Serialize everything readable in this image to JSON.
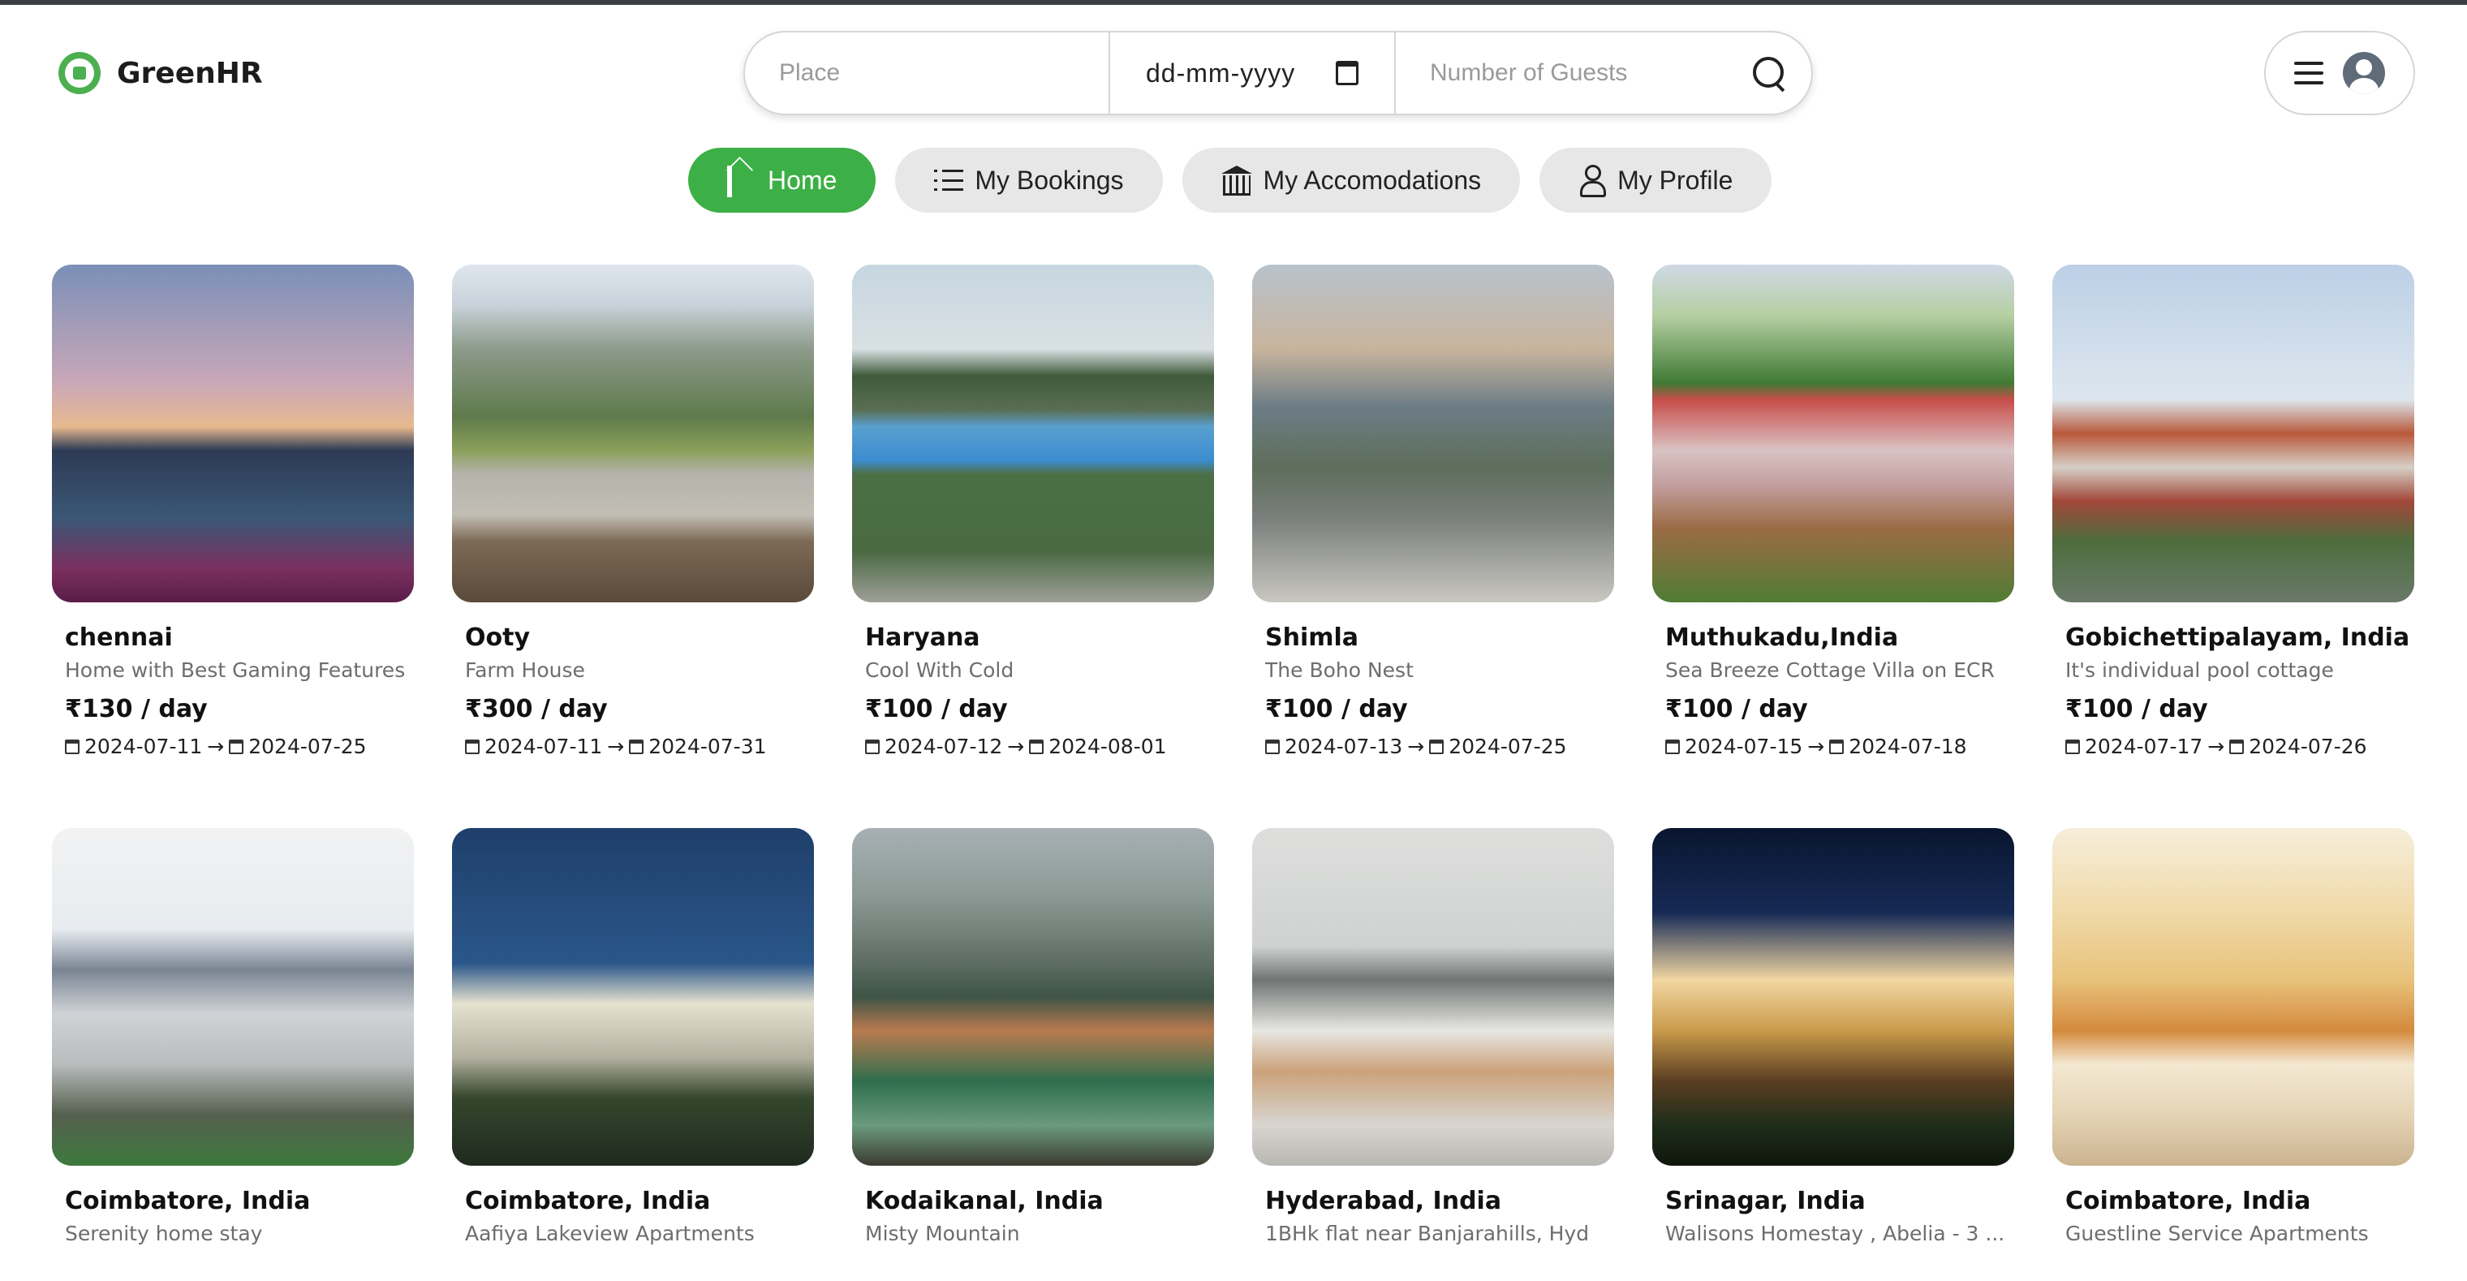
{
  "brand": {
    "name": "GreenHR",
    "logo_icon": "house-leaf-logo",
    "accent": "#3caf46"
  },
  "search": {
    "place_placeholder": "Place",
    "date_value": "dd-mm-yyyy",
    "guests_placeholder": "Number of Guests",
    "search_icon": "search-icon"
  },
  "account": {
    "menu_icon": "hamburger-icon",
    "avatar_icon": "user-avatar-icon"
  },
  "tabs": [
    {
      "label": "Home",
      "icon": "home-icon",
      "active": true
    },
    {
      "label": "My Bookings",
      "icon": "list-icon",
      "active": false
    },
    {
      "label": "My Accomodations",
      "icon": "bank-icon",
      "active": false
    },
    {
      "label": "My Profile",
      "icon": "user-icon",
      "active": false
    }
  ],
  "listings": [
    {
      "title": "chennai",
      "subtitle": "Home with Best Gaming Features",
      "price": "₹130 / day",
      "from": "2024-07-11",
      "to": "2024-07-25"
    },
    {
      "title": "Ooty",
      "subtitle": "Farm House",
      "price": "₹300 / day",
      "from": "2024-07-11",
      "to": "2024-07-31"
    },
    {
      "title": "Haryana",
      "subtitle": "Cool With Cold",
      "price": "₹100 / day",
      "from": "2024-07-12",
      "to": "2024-08-01"
    },
    {
      "title": "Shimla",
      "subtitle": "The Boho Nest",
      "price": "₹100 / day",
      "from": "2024-07-13",
      "to": "2024-07-25"
    },
    {
      "title": "Muthukadu,India",
      "subtitle": "Sea Breeze Cottage Villa on ECR",
      "price": "₹100 / day",
      "from": "2024-07-15",
      "to": "2024-07-18"
    },
    {
      "title": "Gobichettipalayam, India",
      "subtitle": "It's individual pool cottage",
      "price": "₹100 / day",
      "from": "2024-07-17",
      "to": "2024-07-26"
    },
    {
      "title": "Coimbatore, India",
      "subtitle": "Serenity home stay"
    },
    {
      "title": "Coimbatore, India",
      "subtitle": "Aafiya Lakeview Apartments"
    },
    {
      "title": "Kodaikanal, India",
      "subtitle": "Misty Mountain"
    },
    {
      "title": "Hyderabad, India",
      "subtitle": "1BHk flat near Banjarahills, Hyd"
    },
    {
      "title": "Srinagar, India",
      "subtitle": "Walisons Homestay , Abelia - 3 ..."
    },
    {
      "title": "Coimbatore, India",
      "subtitle": "Guestline Service Apartments"
    }
  ],
  "arrow": "→"
}
